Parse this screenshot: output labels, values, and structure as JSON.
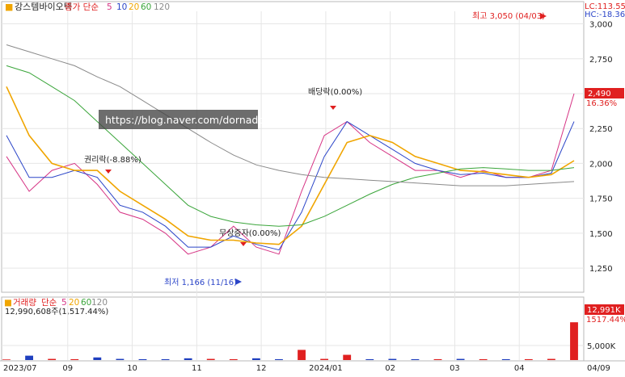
{
  "header": {
    "stock_name": "강스템바이오텍",
    "price_legend": "종가 단순",
    "ma_periods": [
      "5",
      "10",
      "20",
      "60",
      "120"
    ],
    "lc_text": "LC:113.55",
    "hc_text": "HC:-18.36"
  },
  "volume_header": {
    "label": "거래량",
    "ma_label": "단순",
    "ma_periods": [
      "5",
      "20",
      "60",
      "120"
    ],
    "value_text": "12,990,608주(1,517.44%)"
  },
  "annotations": {
    "high": "최고 3,050 (04/03)",
    "low": "최저 1,166 (11/16)",
    "ex_rights": "권리락(-8.88%)",
    "ex_dividend": "배당락(0.00%)",
    "capital_increase": "무상증자(0.00%)",
    "watermark": "https://blog.naver.com/dornado"
  },
  "price_tag": {
    "value": "2,490",
    "change": "16.36%"
  },
  "volume_tag": {
    "value": "12,991K",
    "change": "1517.44%"
  },
  "colors": {
    "up": "#e02020",
    "down": "#1f3fbf",
    "ma5": "#d63384",
    "ma10": "#2b45c8",
    "ma20": "#f0a500",
    "ma60": "#3aa53a",
    "ma120": "#8a8a8a",
    "axis_text": "#222222",
    "grid": "#e6e6e6",
    "header_bar": "#e8f1fb"
  },
  "chart_data": {
    "type": "candlestick",
    "price_axis": {
      "ticks": [
        1250,
        1500,
        1750,
        2000,
        2250,
        2500,
        2750,
        3000
      ],
      "tick_labels": [
        "1,250",
        "1,500",
        "1,750",
        "2,000",
        "2,250",
        "2,500",
        "2,750",
        "3,000"
      ],
      "range": [
        1100,
        3090
      ]
    },
    "volume_axis": {
      "ticks": [
        5000
      ],
      "tick_labels": [
        "5,000K"
      ],
      "range": [
        0,
        15000
      ]
    },
    "x_axis": {
      "labels": [
        "2023/07",
        "09",
        "10",
        "11",
        "12",
        "2024/01",
        "02",
        "03",
        "04",
        "04/09"
      ]
    },
    "series": [
      {
        "name": "5",
        "values": [
          2050,
          1800,
          1950,
          2000,
          1850,
          1650,
          1600,
          1500,
          1350,
          1400,
          1550,
          1400,
          1350,
          1800,
          2200,
          2300,
          2150,
          2050,
          1950,
          1950,
          1900,
          1950,
          1900,
          1900,
          1950,
          2500
        ]
      },
      {
        "name": "10",
        "values": [
          2200,
          1900,
          1900,
          1950,
          1900,
          1700,
          1650,
          1550,
          1400,
          1400,
          1480,
          1420,
          1380,
          1650,
          2050,
          2300,
          2200,
          2100,
          2000,
          1950,
          1920,
          1930,
          1900,
          1900,
          1930,
          2300
        ]
      },
      {
        "name": "20",
        "values": [
          2550,
          2200,
          2000,
          1950,
          1950,
          1800,
          1700,
          1600,
          1480,
          1450,
          1450,
          1430,
          1420,
          1550,
          1850,
          2150,
          2200,
          2150,
          2050,
          2000,
          1950,
          1940,
          1920,
          1900,
          1920,
          2020
        ]
      },
      {
        "name": "60",
        "values": [
          2700,
          2650,
          2550,
          2450,
          2300,
          2150,
          2000,
          1850,
          1700,
          1620,
          1580,
          1560,
          1550,
          1560,
          1620,
          1700,
          1780,
          1850,
          1900,
          1930,
          1960,
          1970,
          1960,
          1950,
          1950,
          1970
        ]
      },
      {
        "name": "120",
        "values": [
          2850,
          2800,
          2750,
          2700,
          2620,
          2550,
          2450,
          2350,
          2250,
          2150,
          2060,
          1990,
          1950,
          1920,
          1900,
          1890,
          1880,
          1870,
          1860,
          1850,
          1840,
          1840,
          1840,
          1850,
          1860,
          1870
        ]
      }
    ],
    "volume": [
      200,
      1500,
      400,
      300,
      900,
      400,
      300,
      300,
      600,
      400,
      300,
      600,
      300,
      3500,
      400,
      1800,
      300,
      400,
      300,
      300,
      400,
      300,
      300,
      300,
      400,
      13000
    ]
  }
}
